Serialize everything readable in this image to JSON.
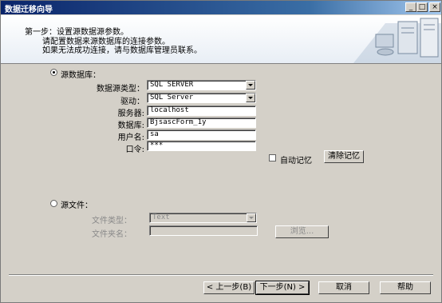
{
  "window": {
    "title": "数据迁移向导",
    "controls": {
      "minimize": "_",
      "maximize": "□",
      "close": "×"
    }
  },
  "header": {
    "step": "第一步：设置源数据源参数。",
    "desc_line1": "请配置数据来源数据库的连接参数。",
    "desc_line2": "如果无法成功连接，请与数据库管理员联系。"
  },
  "source_db": {
    "radio_label": "源数据库：",
    "selected": true,
    "fields": {
      "datasource_type": {
        "label": "数据源类型：",
        "value": "SQL SERVER"
      },
      "driver": {
        "label": "驱动：",
        "value": "SQL Server"
      },
      "server": {
        "label": "服务器:",
        "value": "localhost"
      },
      "database": {
        "label": "数据库:",
        "value": "BjsascForm_1y"
      },
      "username": {
        "label": "用户名:",
        "value": "sa"
      },
      "password": {
        "label": "口令:",
        "value": "***"
      }
    },
    "auto_remember": {
      "label": "自动记忆",
      "checked": false
    },
    "clear_memory_label": "清除记忆"
  },
  "source_file": {
    "radio_label": "源文件：",
    "selected": false,
    "file_type": {
      "label": "文件类型：",
      "value": "Text"
    },
    "file_name": {
      "label": "文件夹名：",
      "value": ""
    },
    "browse_label": "浏览..."
  },
  "footer": {
    "prev_label": "< 上一步(B)",
    "next_label": "下一步(N) >",
    "cancel_label": "取消",
    "help_label": "帮助"
  }
}
